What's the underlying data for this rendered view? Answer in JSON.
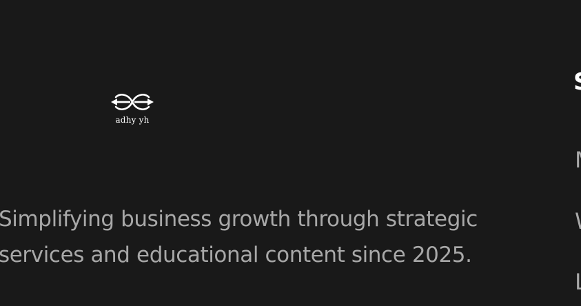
{
  "footer": {
    "brand": {
      "logo_icon": "infinity-arrows-logo",
      "logo_text": "adhy yh",
      "color": "#ffffff"
    },
    "tagline_line1": "Simplifying business growth through strategic",
    "tagline_line2": "services and educational content since 2025.",
    "right_column": {
      "heading": "S",
      "links": [
        "M",
        "W",
        "L"
      ]
    },
    "colors": {
      "background": "#191919",
      "text_muted": "#a8a8a8",
      "text_heading": "#ffffff"
    }
  }
}
